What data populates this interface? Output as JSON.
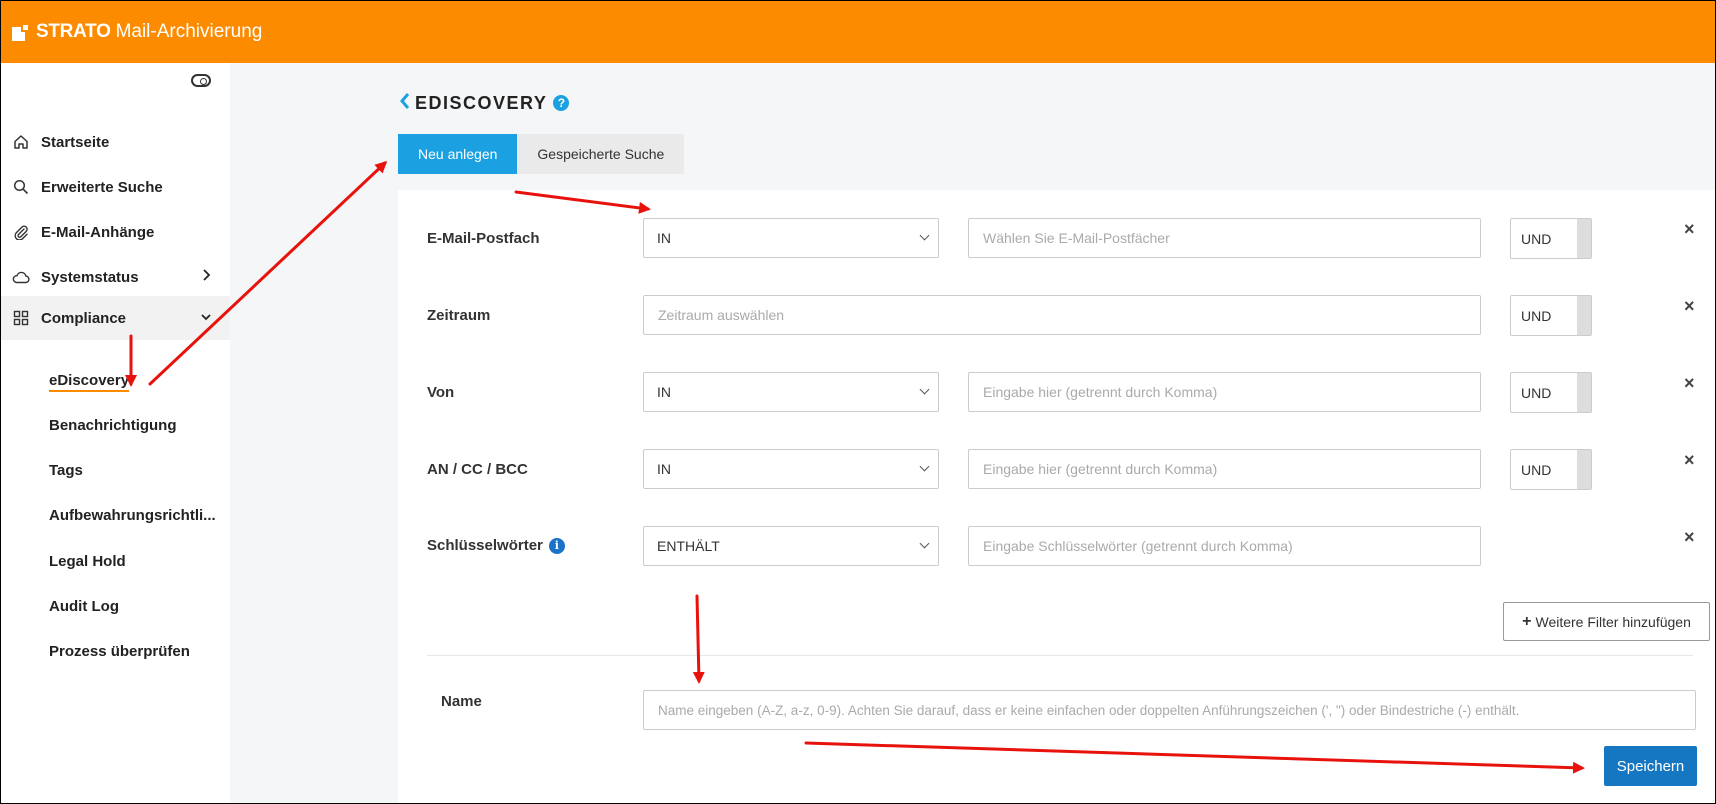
{
  "header": {
    "brand": "STRATO",
    "product": "Mail-Archivierung",
    "color": "#fd8b00"
  },
  "sidebar": {
    "items": [
      {
        "label": "Startseite",
        "icon": "home-icon"
      },
      {
        "label": "Erweiterte Suche",
        "icon": "search-icon"
      },
      {
        "label": "E-Mail-Anhänge",
        "icon": "paperclip-icon"
      },
      {
        "label": "Systemstatus",
        "icon": "cloud-icon"
      },
      {
        "label": "Compliance",
        "icon": "grid-icon"
      }
    ],
    "sub_items": [
      "eDiscovery",
      "Benachrichtigung",
      "Tags",
      "Aufbewahrungsrichtli...",
      "Legal Hold",
      "Audit Log",
      "Prozess überprüfen"
    ]
  },
  "page": {
    "title": "EDISCOVERY",
    "help": "?",
    "tabs": [
      "Neu anlegen",
      "Gespeicherte Suche"
    ]
  },
  "filters": [
    {
      "label": "E-Mail-Postfach",
      "operator": "IN",
      "placeholder": "Wählen Sie E-Mail-Postfächer",
      "logic": "UND"
    },
    {
      "label": "Zeitraum",
      "placeholder": "Zeitraum auswählen",
      "logic": "UND"
    },
    {
      "label": "Von",
      "operator": "IN",
      "placeholder": "Eingabe hier (getrennt durch Komma)",
      "logic": "UND"
    },
    {
      "label": "AN / CC / BCC",
      "operator": "IN",
      "placeholder": "Eingabe hier (getrennt durch Komma)",
      "logic": "UND"
    },
    {
      "label": "Schlüsselwörter",
      "operator": "ENTHÄLT",
      "placeholder": "Eingabe Schlüsselwörter (getrennt durch Komma)",
      "info": "i"
    }
  ],
  "add_filter_label": "Weitere Filter hinzufügen",
  "name": {
    "label": "Name",
    "placeholder": "Name eingeben (A-Z, a-z, 0-9). Achten Sie darauf, dass er keine einfachen oder doppelten Anführungszeichen (', \") oder Bindestriche (-) enthält."
  },
  "save_label": "Speichern",
  "close_glyph": "×",
  "colors": {
    "accent": "#1ba1e2",
    "primary_button": "#1577c1",
    "annotation": "#e8120c"
  }
}
